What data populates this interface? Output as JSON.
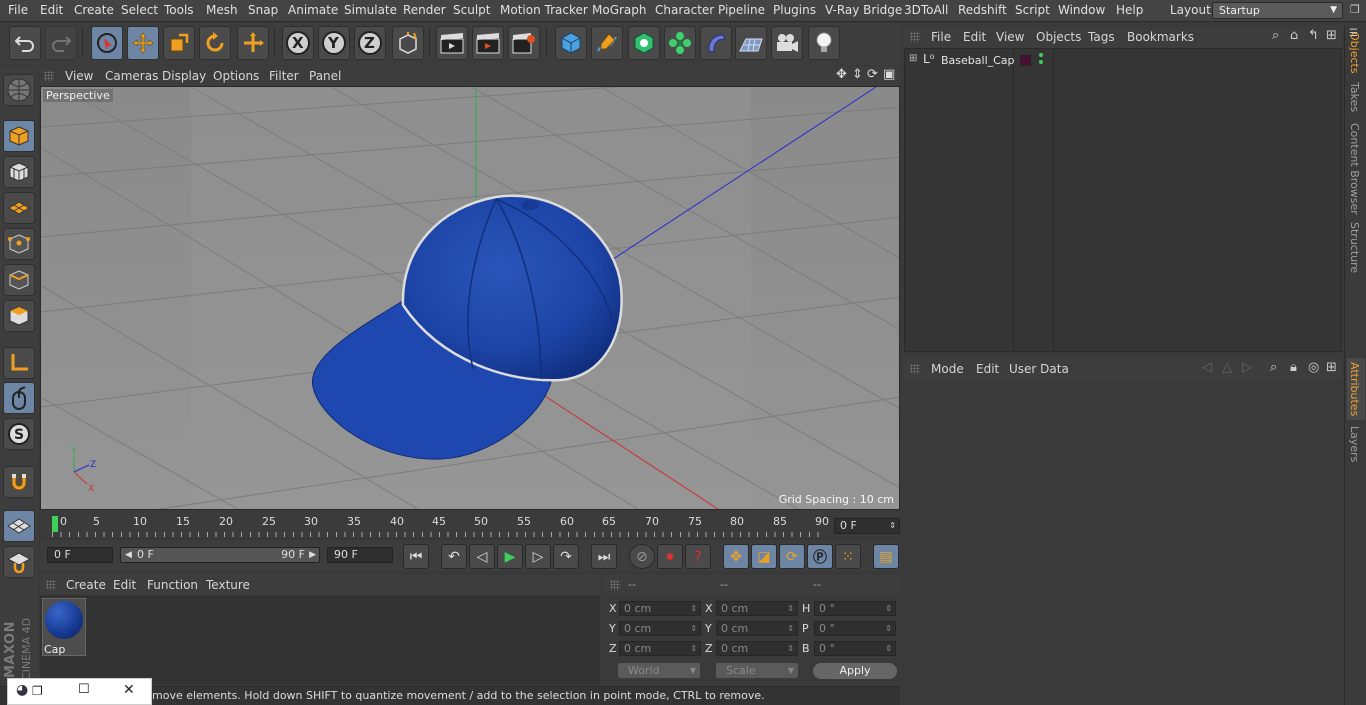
{
  "menubar": {
    "items": [
      "File",
      "Edit",
      "Create",
      "Select",
      "Tools",
      "Mesh",
      "Snap",
      "Animate",
      "Simulate",
      "Render",
      "Sculpt",
      "Motion Tracker",
      "MoGraph",
      "Character",
      "Pipeline",
      "Plugins",
      "V-Ray Bridge",
      "3DToAll",
      "Redshift",
      "Script",
      "Window",
      "Help"
    ],
    "layout_label": "Layout:",
    "layout_value": "Startup"
  },
  "toolbar": {
    "axis_x": "X",
    "axis_y": "Y",
    "axis_z": "Z"
  },
  "viewport": {
    "menu": [
      "View",
      "Cameras",
      "Display",
      "Options",
      "Filter",
      "Panel"
    ],
    "label": "Perspective",
    "grid_spacing": "Grid Spacing : 10 cm"
  },
  "timeline": {
    "ticks": [
      "0",
      "5",
      "10",
      "15",
      "20",
      "25",
      "30",
      "35",
      "40",
      "45",
      "50",
      "55",
      "60",
      "65",
      "70",
      "75",
      "80",
      "85",
      "90"
    ],
    "current_frame": "0 F"
  },
  "transport": {
    "start_field": "0 F",
    "range_start": "0 F",
    "range_end": "90 F",
    "end_field": "90 F"
  },
  "material_manager": {
    "menu": [
      "Create",
      "Edit",
      "Function",
      "Texture"
    ],
    "materials": [
      {
        "name": "Cap",
        "color": "#1d45a8"
      }
    ]
  },
  "coordinates": {
    "headers": [
      "--",
      "--",
      "--"
    ],
    "rows": [
      {
        "l1": "X",
        "v1": "0 cm",
        "l2": "X",
        "v2": "0 cm",
        "l3": "H",
        "v3": "0 °"
      },
      {
        "l1": "Y",
        "v1": "0 cm",
        "l2": "Y",
        "v2": "0 cm",
        "l3": "P",
        "v3": "0 °"
      },
      {
        "l1": "Z",
        "v1": "0 cm",
        "l2": "Z",
        "v2": "0 cm",
        "l3": "B",
        "v3": "0 °"
      }
    ],
    "mode_world": "World",
    "mode_scale": "Scale",
    "apply_label": "Apply"
  },
  "status": {
    "text": "move elements. Hold down SHIFT to quantize movement / add to the selection in point mode, CTRL to remove."
  },
  "object_manager": {
    "menu": [
      "File",
      "Edit",
      "View",
      "Objects",
      "Tags",
      "Bookmarks"
    ],
    "objects": [
      {
        "name": "Baseball_Cap",
        "layer_color": "#4a1030"
      }
    ]
  },
  "attribute_manager": {
    "menu": [
      "Mode",
      "Edit",
      "User Data"
    ]
  },
  "side_tabs": [
    "Objects",
    "Takes",
    "Content Browser",
    "Structure"
  ],
  "side_tabs_lower": [
    "Attributes",
    "Layers"
  ],
  "logo": {
    "brand": "MAXON",
    "product": "CINEMA 4D"
  },
  "colors": {
    "accent_blue": "#6e86a6",
    "cap_blue": "#1d45a8",
    "active_tab": "#f0a030"
  }
}
